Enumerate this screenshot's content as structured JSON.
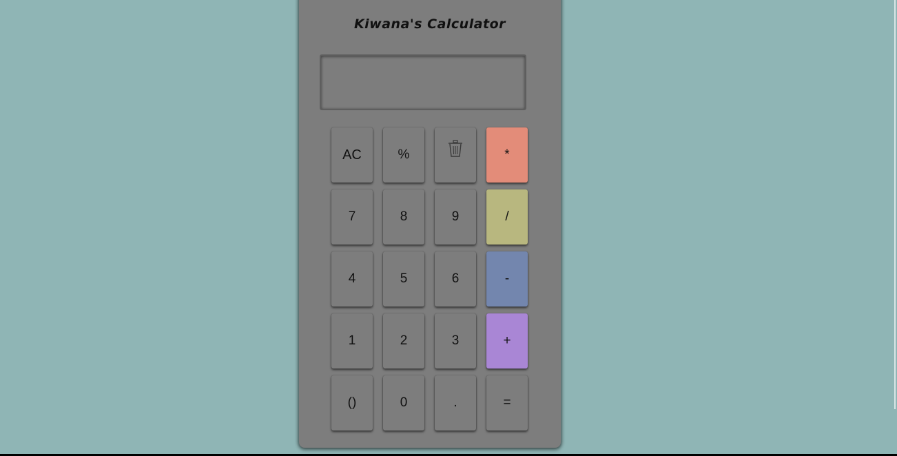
{
  "app": {
    "title": "Kiwana's Calculator"
  },
  "display": {
    "value": ""
  },
  "keys": [
    {
      "label": "AC",
      "name": "all-clear-button",
      "color": "#7d7d7d"
    },
    {
      "label": "%",
      "name": "percent-button",
      "color": "#7d7d7d"
    },
    {
      "label": "",
      "name": "delete-button",
      "icon": "trash-icon",
      "color": "#7d7d7d"
    },
    {
      "label": "*",
      "name": "multiply-button",
      "color": "#e38c79"
    },
    {
      "label": "7",
      "name": "digit-7-button",
      "color": "#7d7d7d"
    },
    {
      "label": "8",
      "name": "digit-8-button",
      "color": "#7d7d7d"
    },
    {
      "label": "9",
      "name": "digit-9-button",
      "color": "#7d7d7d"
    },
    {
      "label": "/",
      "name": "divide-button",
      "color": "#b8b77f"
    },
    {
      "label": "4",
      "name": "digit-4-button",
      "color": "#7d7d7d"
    },
    {
      "label": "5",
      "name": "digit-5-button",
      "color": "#7d7d7d"
    },
    {
      "label": "6",
      "name": "digit-6-button",
      "color": "#7d7d7d"
    },
    {
      "label": "-",
      "name": "subtract-button",
      "color": "#7386ae"
    },
    {
      "label": "1",
      "name": "digit-1-button",
      "color": "#7d7d7d"
    },
    {
      "label": "2",
      "name": "digit-2-button",
      "color": "#7d7d7d"
    },
    {
      "label": "3",
      "name": "digit-3-button",
      "color": "#7d7d7d"
    },
    {
      "label": "+",
      "name": "add-button",
      "color": "#a986d5"
    },
    {
      "label": "()",
      "name": "parentheses-button",
      "color": "#7d7d7d"
    },
    {
      "label": "0",
      "name": "digit-0-button",
      "color": "#7d7d7d"
    },
    {
      "label": ".",
      "name": "decimal-button",
      "color": "#7d7d7d"
    },
    {
      "label": "=",
      "name": "equals-button",
      "color": "#7d7d7d"
    }
  ],
  "colors": {
    "page_background": "#8fb5b5",
    "calculator_body": "#7d7d7d",
    "multiply_key": "#e38c79",
    "divide_key": "#b8b77f",
    "subtract_key": "#7386ae",
    "add_key": "#a986d5"
  }
}
